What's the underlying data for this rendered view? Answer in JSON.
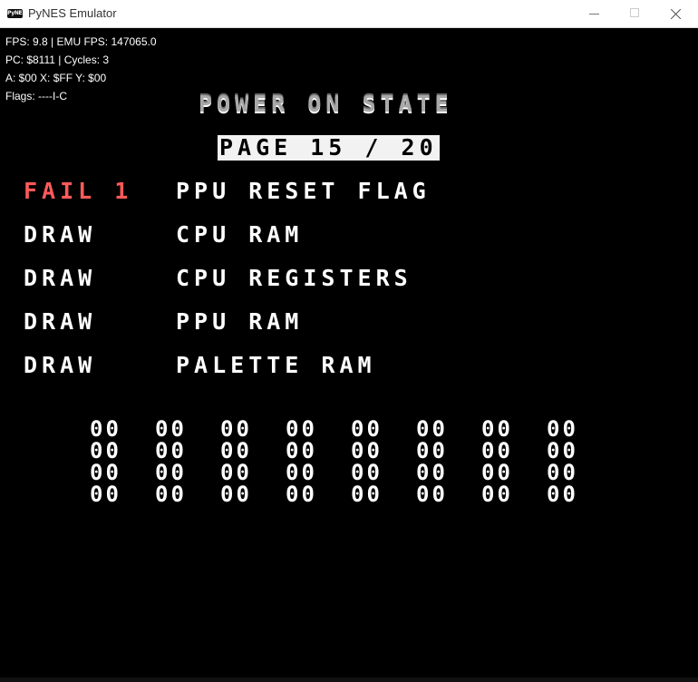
{
  "window": {
    "title": "PyNES Emulator",
    "icon_label": "PyNES"
  },
  "debug": {
    "fps": "FPS: 9.8 | EMU FPS: 147065.0",
    "pc": "PC: $8111 | Cycles: 3",
    "regs": "A: $00 X: $FF Y: $00",
    "flags": "Flags: ----I-C"
  },
  "screen": {
    "heading": "POWER ON STATE",
    "page": "PAGE 15 / 20",
    "tests": [
      {
        "status": "FAIL 1",
        "name": "PPU RESET FLAG"
      },
      {
        "status": "DRAW",
        "name": "CPU RAM"
      },
      {
        "status": "DRAW",
        "name": "CPU REGISTERS"
      },
      {
        "status": "DRAW",
        "name": "PPU RAM"
      },
      {
        "status": "DRAW",
        "name": "PALETTE RAM"
      }
    ],
    "hex_rows": [
      [
        "00",
        "00",
        "00",
        "00",
        "00",
        "00",
        "00",
        "00"
      ],
      [
        "00",
        "00",
        "00",
        "00",
        "00",
        "00",
        "00",
        "00"
      ],
      [
        "00",
        "00",
        "00",
        "00",
        "00",
        "00",
        "00",
        "00"
      ],
      [
        "00",
        "00",
        "00",
        "00",
        "00",
        "00",
        "00",
        "00"
      ]
    ]
  },
  "colors": {
    "fail": "#ff5a5a",
    "text": "#ffffff",
    "background": "#000000"
  }
}
